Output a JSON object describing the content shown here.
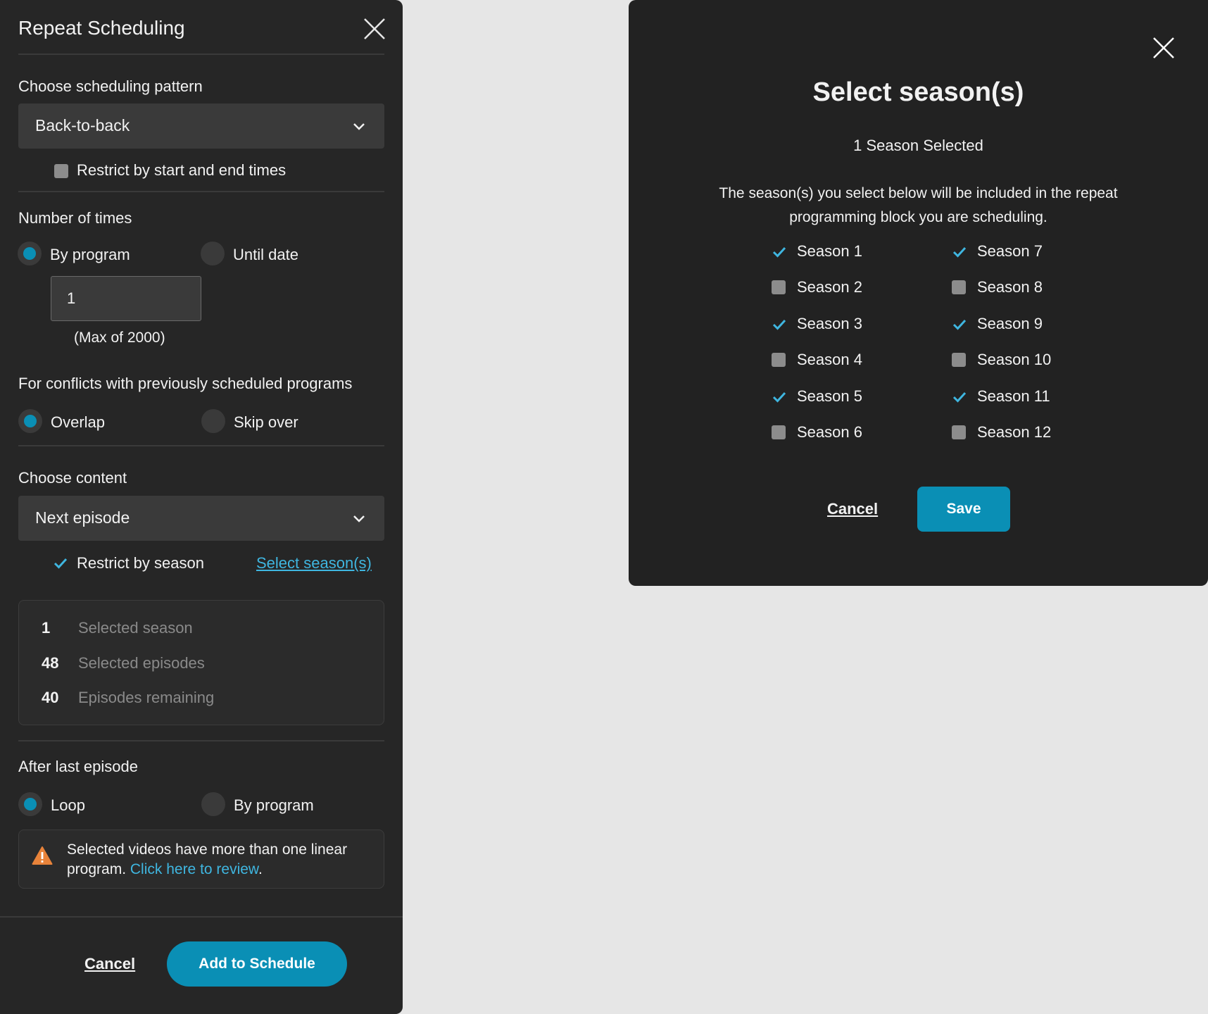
{
  "panel": {
    "title": "Repeat Scheduling",
    "pattern_label": "Choose scheduling pattern",
    "pattern_value": "Back-to-back",
    "restrict_times_label": "Restrict by start and end times",
    "restrict_times_checked": false,
    "times_label": "Number of times",
    "times_options": [
      "By program",
      "Until date"
    ],
    "times_selected": "By program",
    "times_value": "1",
    "times_hint": "(Max of 2000)",
    "conflicts_label": "For conflicts with previously scheduled programs",
    "conflict_options": [
      "Overlap",
      "Skip over"
    ],
    "conflict_selected": "Overlap",
    "content_label": "Choose content",
    "content_value": "Next episode",
    "restrict_season_label": "Restrict by season",
    "restrict_season_checked": true,
    "select_seasons_link": "Select season(s)",
    "summary": [
      {
        "count": "1",
        "label": "Selected season"
      },
      {
        "count": "48",
        "label": "Selected episodes"
      },
      {
        "count": "40",
        "label": "Episodes remaining"
      }
    ],
    "after_label": "After last episode",
    "after_options": [
      "Loop",
      "By program"
    ],
    "after_selected": "Loop",
    "warning_text": "Selected videos have more than one linear program.",
    "warning_link": "Click here to review",
    "warning_end": ".",
    "cancel_label": "Cancel",
    "add_label": "Add to Schedule"
  },
  "modal": {
    "title": "Select season(s)",
    "subtitle": "1 Season Selected",
    "description": "The season(s) you select below will be included in the repeat programming block you are scheduling.",
    "seasons": [
      {
        "label": "Season 1",
        "checked": true
      },
      {
        "label": "Season 2",
        "checked": false
      },
      {
        "label": "Season 3",
        "checked": true
      },
      {
        "label": "Season 4",
        "checked": false
      },
      {
        "label": "Season 5",
        "checked": true
      },
      {
        "label": "Season 6",
        "checked": false
      },
      {
        "label": "Season 7",
        "checked": true
      },
      {
        "label": "Season 8",
        "checked": false
      },
      {
        "label": "Season 9",
        "checked": true
      },
      {
        "label": "Season 10",
        "checked": false
      },
      {
        "label": "Season 11",
        "checked": true
      },
      {
        "label": "Season 12",
        "checked": false
      }
    ],
    "cancel_label": "Cancel",
    "save_label": "Save"
  },
  "colors": {
    "accent": "#0a8fb5",
    "link": "#3fb6e0",
    "panel_bg": "#262626",
    "modal_bg": "#222222",
    "page_bg": "#e6e6e6",
    "warning": "#e8833a"
  },
  "icons": [
    "close-icon",
    "chevron-down-icon",
    "check-icon",
    "warning-icon"
  ]
}
